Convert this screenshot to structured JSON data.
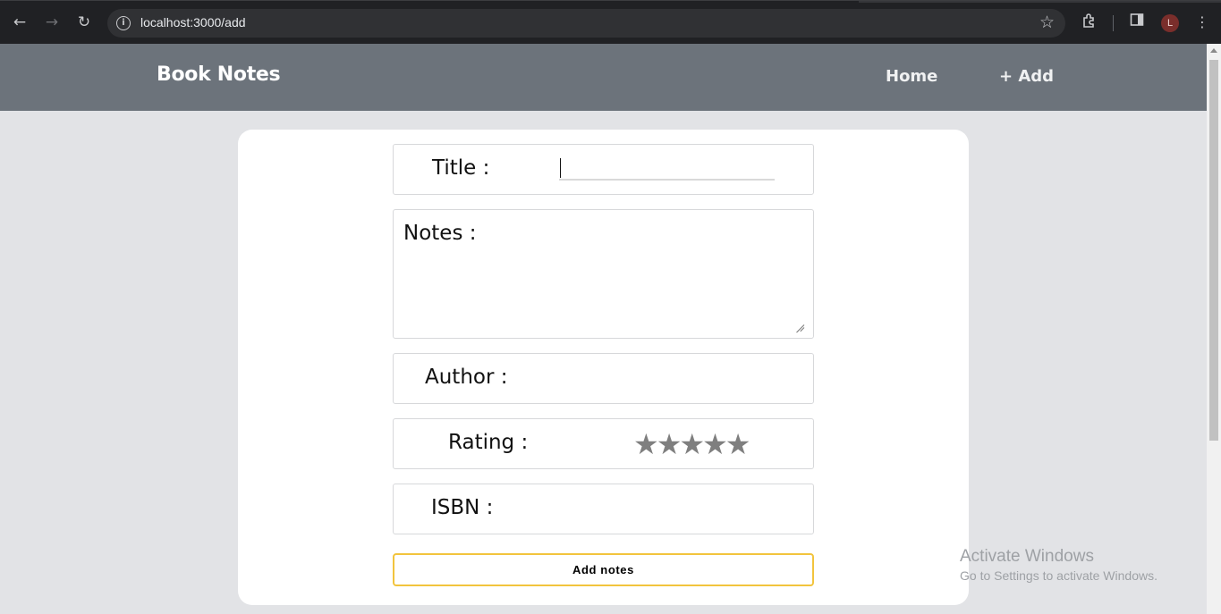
{
  "browser": {
    "url": "localhost:3000/add",
    "avatar_initial": "L"
  },
  "app": {
    "brand": "Book Notes",
    "nav": {
      "home": "Home",
      "add": "+ Add"
    }
  },
  "form": {
    "title_label": "Title :",
    "title_value": "",
    "notes_label": "Notes :",
    "author_label": "Author :",
    "rating_label": "Rating :",
    "rating_stars": "★★★★★",
    "rating_value": 0,
    "isbn_label": "ISBN :",
    "submit_label": "Add notes"
  },
  "watermark": {
    "line1": "Activate Windows",
    "line2": "Go to Settings to activate Windows."
  },
  "colors": {
    "navbar": "#6c737b",
    "page_bg": "#e2e3e6",
    "submit_border": "#f2c43d",
    "star": "#7f7f7f"
  }
}
